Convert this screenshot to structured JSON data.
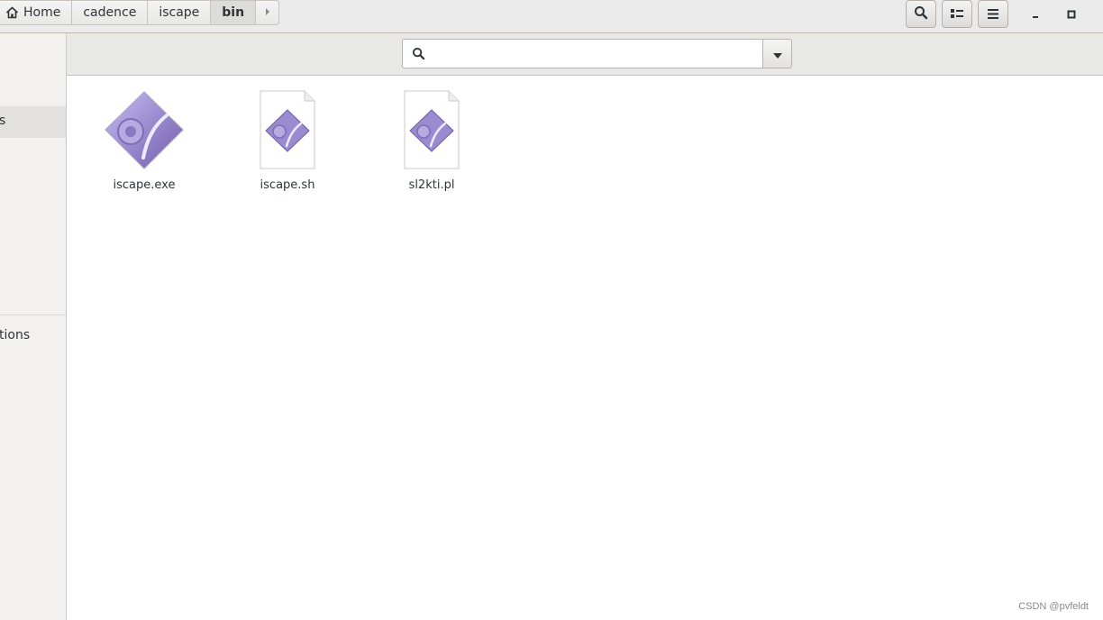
{
  "pathbar": {
    "home_label": "Home",
    "crumbs": [
      "cadence",
      "iscape",
      "bin"
    ],
    "active_crumb": "bin"
  },
  "header_icons": {
    "search": "search-icon",
    "view": "view-toggle-icon",
    "menu": "hamburger-menu-icon",
    "minimize": "minimize-icon",
    "maximize": "maximize-icon"
  },
  "sidebar": {
    "item_partial_1": "s",
    "item_partial_2": "tions"
  },
  "search": {
    "value": "",
    "placeholder": ""
  },
  "files": [
    {
      "name": "iscape.exe",
      "icon": "executable-icon"
    },
    {
      "name": "iscape.sh",
      "icon": "script-file-icon"
    },
    {
      "name": "sl2kti.pl",
      "icon": "script-file-icon"
    }
  ],
  "colors": {
    "icon_purple": "#8e7cc3",
    "header_bg": "#ebebeb",
    "sidebar_bg": "#f2f1f0"
  },
  "watermark": "CSDN @pvfeldt"
}
